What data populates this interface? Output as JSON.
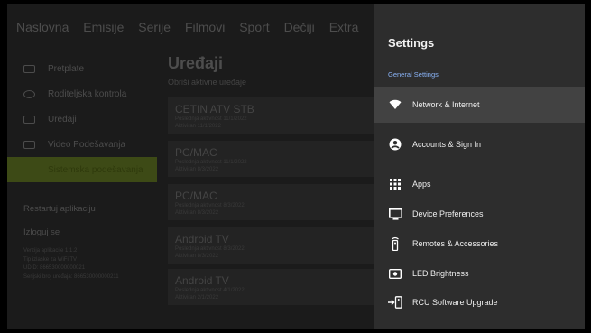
{
  "nav": [
    "Naslovna",
    "Emisije",
    "Serije",
    "Filmovi",
    "Sport",
    "Dečiji",
    "Extra"
  ],
  "sidebar": {
    "items": [
      {
        "label": "Pretplate",
        "icon": "subscription-icon"
      },
      {
        "label": "Roditeljska kontrola",
        "icon": "eye-icon"
      },
      {
        "label": "Uređaji",
        "icon": "devices-icon"
      },
      {
        "label": "Video Podešavanja",
        "icon": "video-icon"
      },
      {
        "label": "Sistemska podešavanja",
        "icon": ""
      }
    ],
    "restart": "Restartuj aplikaciju",
    "logout": "Izloguj se",
    "info": [
      "Verzija aplikacije 1.1.2",
      "Tip izlaske za WiFi TV",
      "UDID: 866530000000021",
      "Serijski broj uređaja: 866530000000211"
    ]
  },
  "main": {
    "title": "Uređaji",
    "subtitle": "Obriši aktivne uređaje",
    "devices": [
      {
        "name": "CETIN ATV STB",
        "line1": "Poslednja aktivnost 11/1/2022",
        "line2": "Aktiviran 11/1/2022"
      },
      {
        "name": "PC/MAC",
        "line1": "Poslednja aktivnost 11/1/2022",
        "line2": "Aktiviran 8/3/2022"
      },
      {
        "name": "PC/MAC",
        "line1": "Poslednja aktivnost 8/3/2022",
        "line2": "Aktiviran 8/3/2022"
      },
      {
        "name": "Android TV",
        "line1": "Poslednja aktivnost 8/3/2022",
        "line2": "Aktiviran 8/3/2022"
      },
      {
        "name": "Android TV",
        "line1": "Poslednja aktivnost 4/1/2022",
        "line2": "Aktiviran 2/1/2022"
      }
    ]
  },
  "settings": {
    "title": "Settings",
    "section": "General Settings",
    "items": [
      {
        "label": "Network & Internet",
        "icon": "wifi-icon"
      },
      {
        "label": "Accounts & Sign In",
        "icon": "account-icon"
      },
      {
        "label": "Apps",
        "icon": "apps-grid-icon"
      },
      {
        "label": "Device Preferences",
        "icon": "tv-icon"
      },
      {
        "label": "Remotes & Accessories",
        "icon": "remote-icon"
      },
      {
        "label": "LED Brightness",
        "icon": "led-icon"
      },
      {
        "label": "RCU Software Upgrade",
        "icon": "rcu-upgrade-icon"
      }
    ],
    "selected_index": 0,
    "accent": "#8ab4f8"
  }
}
